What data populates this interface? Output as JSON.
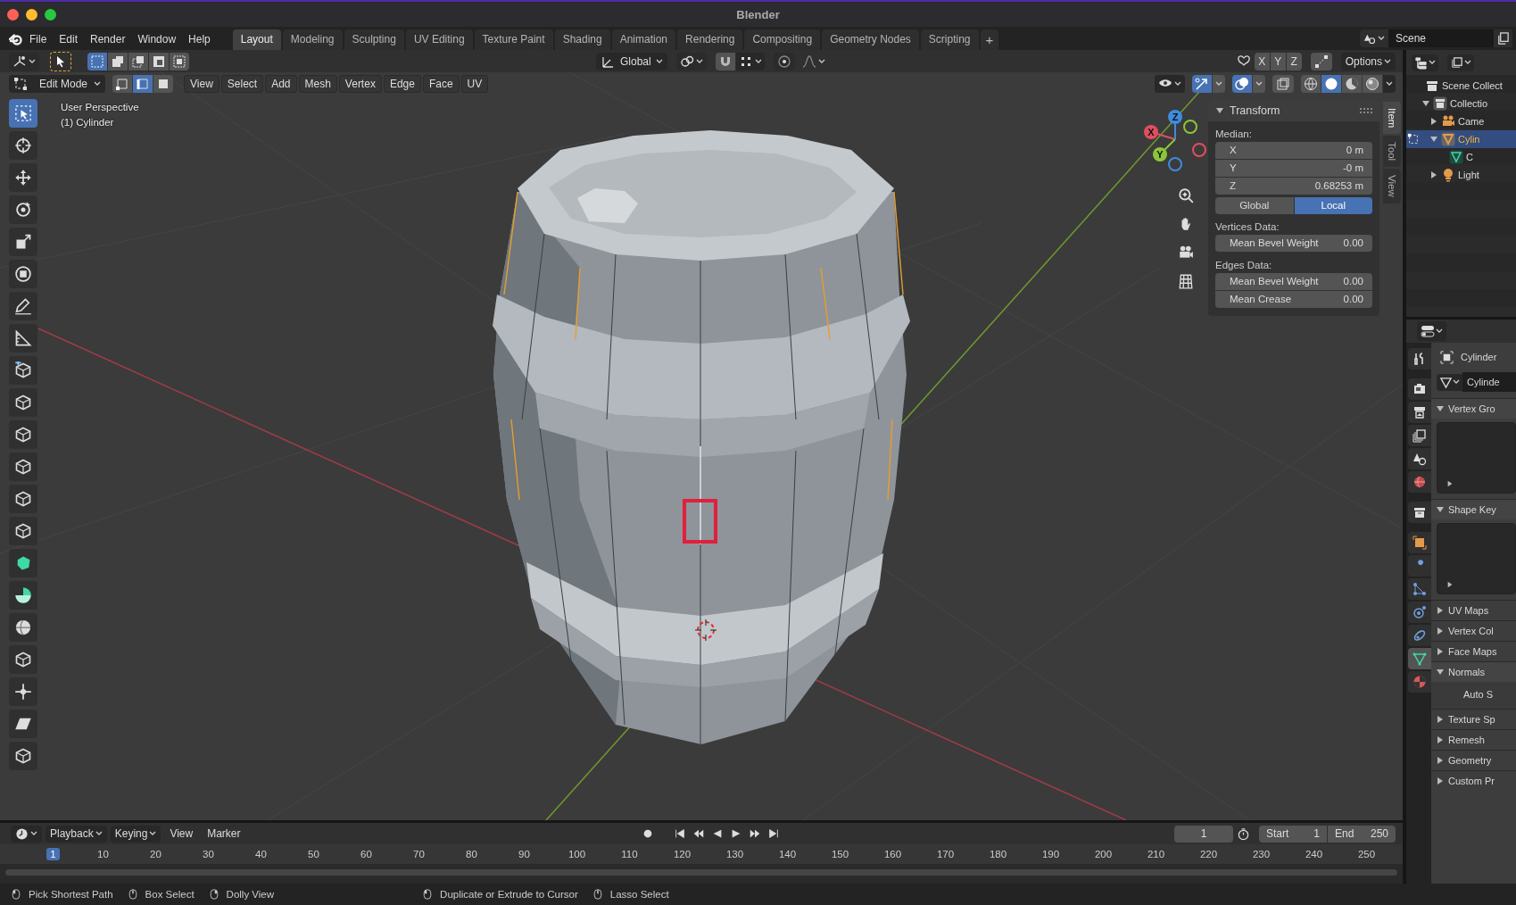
{
  "window": {
    "title": "Blender"
  },
  "menu": [
    "File",
    "Edit",
    "Render",
    "Window",
    "Help"
  ],
  "workspace_tabs": [
    {
      "label": "Layout",
      "selected": true
    },
    {
      "label": "Modeling",
      "selected": false
    },
    {
      "label": "Sculpting",
      "selected": false
    },
    {
      "label": "UV Editing",
      "selected": false
    },
    {
      "label": "Texture Paint",
      "selected": false
    },
    {
      "label": "Shading",
      "selected": false
    },
    {
      "label": "Animation",
      "selected": false
    },
    {
      "label": "Rendering",
      "selected": false
    },
    {
      "label": "Compositing",
      "selected": false
    },
    {
      "label": "Geometry Nodes",
      "selected": false
    },
    {
      "label": "Scripting",
      "selected": false
    }
  ],
  "add_tab": "+",
  "scene": {
    "name": "Scene"
  },
  "tool_header": {
    "select_boxes": [
      {
        "selected": true
      },
      {
        "selected": false
      },
      {
        "selected": false
      },
      {
        "selected": false
      },
      {
        "selected": false
      }
    ],
    "orientation": "Global",
    "mirror_axes": [
      {
        "label": "X",
        "selected": false
      },
      {
        "label": "Y",
        "selected": false
      },
      {
        "label": "Z",
        "selected": false
      }
    ],
    "options": "Options"
  },
  "mode_header": {
    "mode": "Edit Mode",
    "select_modes": [
      {
        "selected": false
      },
      {
        "selected": true
      },
      {
        "selected": false
      }
    ],
    "menus": [
      "View",
      "Select",
      "Add",
      "Mesh",
      "Vertex",
      "Edge",
      "Face",
      "UV"
    ]
  },
  "viewport_toggles": [
    {
      "kind": "gizmo",
      "on": true
    },
    {
      "kind": "overlay",
      "on": true
    }
  ],
  "shading_modes": [
    {
      "selected": false
    },
    {
      "selected": true
    },
    {
      "selected": false
    },
    {
      "selected": false
    }
  ],
  "viewport": {
    "view_name": "User Perspective",
    "object_label": "(1) Cylinder",
    "gizmo": [
      {
        "label": "X",
        "color": "#e04f5f"
      },
      {
        "label": "Y",
        "color": "#8bc63a"
      },
      {
        "label": "Z",
        "color": "#3f8bdd"
      }
    ]
  },
  "tools": [
    {
      "kind": "select",
      "selected": true
    },
    {
      "kind": "cursor",
      "selected": false
    },
    {
      "kind": "move",
      "selected": false
    },
    {
      "kind": "rotate",
      "selected": false
    },
    {
      "kind": "scale",
      "selected": false
    },
    {
      "kind": "transform",
      "selected": false
    },
    {
      "kind": "annotate",
      "selected": false
    },
    {
      "kind": "measure",
      "selected": false
    },
    {
      "kind": "add-cube",
      "selected": false
    },
    {
      "kind": "cube",
      "selected": false
    },
    {
      "kind": "cube",
      "selected": false
    },
    {
      "kind": "cube",
      "selected": false
    },
    {
      "kind": "cube",
      "selected": false
    },
    {
      "kind": "cube",
      "selected": false
    },
    {
      "kind": "poly-build",
      "selected": false
    },
    {
      "kind": "spin",
      "selected": false
    },
    {
      "kind": "smooth",
      "selected": false
    },
    {
      "kind": "cube",
      "selected": false
    },
    {
      "kind": "shrink",
      "selected": false
    },
    {
      "kind": "shear",
      "selected": false
    },
    {
      "kind": "cube",
      "selected": false
    }
  ],
  "sidebar_tabs": [
    {
      "label": "Item",
      "selected": true
    },
    {
      "label": "Tool",
      "selected": false
    },
    {
      "label": "View",
      "selected": false
    }
  ],
  "transform_panel": {
    "title": "Transform",
    "expanded": true,
    "median_label": "Median:",
    "median": [
      {
        "label": "X",
        "value": "0 m"
      },
      {
        "label": "Y",
        "value": "-0 m"
      },
      {
        "label": "Z",
        "value": "0.68253 m"
      }
    ],
    "space": [
      {
        "label": "Global",
        "selected": false
      },
      {
        "label": "Local",
        "selected": true
      }
    ],
    "vertices_label": "Vertices Data:",
    "vertices": [
      {
        "label": "Mean Bevel Weight",
        "value": "0.00"
      }
    ],
    "edges_label": "Edges Data:",
    "edges": [
      {
        "label": "Mean Bevel Weight",
        "value": "0.00"
      },
      {
        "label": "Mean Crease",
        "value": "0.00"
      }
    ]
  },
  "outliner": {
    "items": [
      {
        "kind": "scene-collection",
        "label": "Scene Collect",
        "selected": false,
        "children": [
          {
            "kind": "collection",
            "label": "Collectio",
            "selected": false,
            "expanded": true,
            "children": [
              {
                "kind": "camera",
                "label": "Came",
                "selected": false,
                "expanded": false
              },
              {
                "kind": "mesh",
                "label": "Cylin",
                "selected": true,
                "expanded": true,
                "children": [
                  {
                    "kind": "mesh-data",
                    "label": "C",
                    "selected": false
                  }
                ]
              },
              {
                "kind": "light",
                "label": "Light",
                "selected": false,
                "expanded": false
              }
            ]
          }
        ]
      }
    ]
  },
  "properties": {
    "tabs": [
      {
        "kind": "tool",
        "selected": false
      },
      {
        "kind": "render",
        "selected": false
      },
      {
        "kind": "output",
        "selected": false
      },
      {
        "kind": "view-layer",
        "selected": false
      },
      {
        "kind": "scene",
        "selected": false
      },
      {
        "kind": "world",
        "selected": false
      },
      {
        "kind": "collection",
        "selected": false
      },
      {
        "kind": "object",
        "selected": false
      },
      {
        "kind": "modifier",
        "selected": false
      },
      {
        "kind": "particles",
        "selected": false
      },
      {
        "kind": "physics",
        "selected": false
      },
      {
        "kind": "constraints",
        "selected": false
      },
      {
        "kind": "data",
        "selected": true
      },
      {
        "kind": "material",
        "selected": false
      }
    ],
    "object_name": "Cylinder",
    "mesh_name": "Cylinde",
    "panels": [
      {
        "title": "Vertex Gro",
        "expanded": true,
        "kind": "list"
      },
      {
        "title": "Shape Key",
        "expanded": true,
        "kind": "list"
      },
      {
        "title": "UV Maps",
        "expanded": false
      },
      {
        "title": "Vertex Col",
        "expanded": false
      },
      {
        "title": "Face Maps",
        "expanded": false
      },
      {
        "title": "Normals",
        "expanded": true,
        "kind": "text",
        "content": "Auto S"
      },
      {
        "title": "Texture Sp",
        "expanded": false
      },
      {
        "title": "Remesh",
        "expanded": false
      },
      {
        "title": "Geometry",
        "expanded": false
      },
      {
        "title": "Custom Pr",
        "expanded": false
      }
    ]
  },
  "timeline": {
    "menus": [
      "Playback",
      "Keying",
      "View",
      "Marker"
    ],
    "current_frame": "1",
    "start_label": "Start",
    "start": "1",
    "end_label": "End",
    "end": "250",
    "ruler": [
      {
        "label": "1",
        "selected": true
      },
      {
        "label": "10",
        "selected": false
      },
      {
        "label": "20",
        "selected": false
      },
      {
        "label": "30",
        "selected": false
      },
      {
        "label": "40",
        "selected": false
      },
      {
        "label": "50",
        "selected": false
      },
      {
        "label": "60",
        "selected": false
      },
      {
        "label": "70",
        "selected": false
      },
      {
        "label": "80",
        "selected": false
      },
      {
        "label": "90",
        "selected": false
      },
      {
        "label": "100",
        "selected": false
      },
      {
        "label": "110",
        "selected": false
      },
      {
        "label": "120",
        "selected": false
      },
      {
        "label": "130",
        "selected": false
      },
      {
        "label": "140",
        "selected": false
      },
      {
        "label": "150",
        "selected": false
      },
      {
        "label": "160",
        "selected": false
      },
      {
        "label": "170",
        "selected": false
      },
      {
        "label": "180",
        "selected": false
      },
      {
        "label": "190",
        "selected": false
      },
      {
        "label": "200",
        "selected": false
      },
      {
        "label": "210",
        "selected": false
      },
      {
        "label": "220",
        "selected": false
      },
      {
        "label": "230",
        "selected": false
      },
      {
        "label": "240",
        "selected": false
      },
      {
        "label": "250",
        "selected": false
      }
    ]
  },
  "status_bar": [
    "Pick Shortest Path",
    "Box Select",
    "Dolly View",
    "Duplicate or Extrude to Cursor",
    "Lasso Select"
  ]
}
